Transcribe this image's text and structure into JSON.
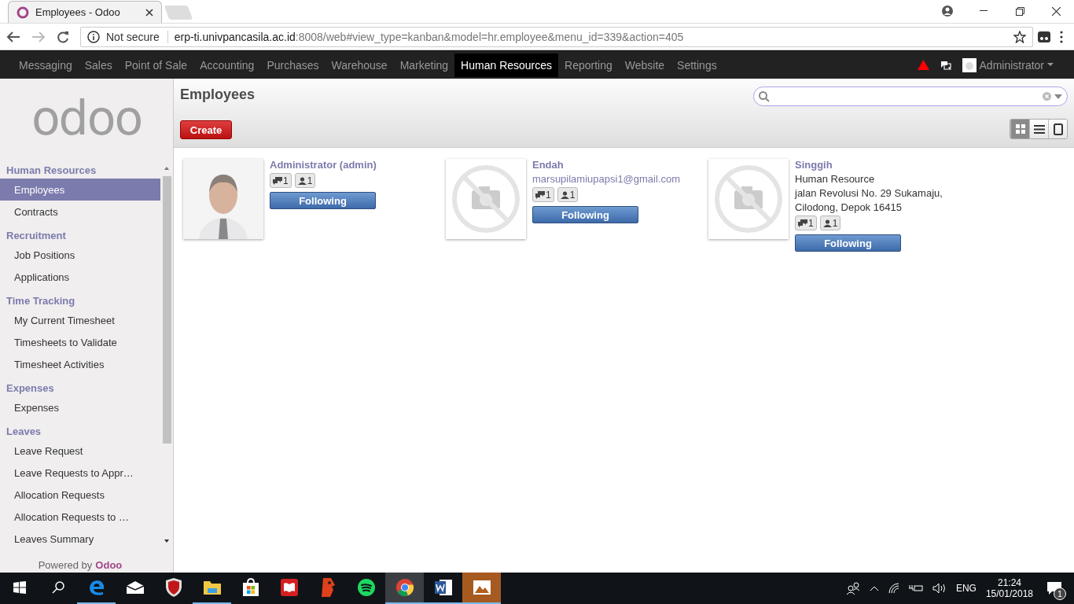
{
  "browser": {
    "tab_title": "Employees - Odoo",
    "security": "Not secure",
    "url_host": "erp-ti.univpancasila.ac.id",
    "url_rest": ":8008/web#view_type=kanban&model=hr.employee&menu_id=339&action=405"
  },
  "topnav": {
    "items": [
      {
        "label": "Messaging",
        "selected": false
      },
      {
        "label": "Sales",
        "selected": false
      },
      {
        "label": "Point of Sale",
        "selected": false
      },
      {
        "label": "Accounting",
        "selected": false
      },
      {
        "label": "Purchases",
        "selected": false
      },
      {
        "label": "Warehouse",
        "selected": false
      },
      {
        "label": "Marketing",
        "selected": false
      },
      {
        "label": "Human Resources",
        "selected": true
      },
      {
        "label": "Reporting",
        "selected": false
      },
      {
        "label": "Website",
        "selected": false
      },
      {
        "label": "Settings",
        "selected": false
      }
    ],
    "user": "Administrator"
  },
  "sidebar": {
    "logo": "odoo",
    "sections": [
      {
        "title": "Human Resources",
        "items": [
          {
            "label": "Employees",
            "selected": true
          },
          {
            "label": "Contracts",
            "selected": false
          }
        ]
      },
      {
        "title": "Recruitment",
        "items": [
          {
            "label": "Job Positions",
            "selected": false
          },
          {
            "label": "Applications",
            "selected": false
          }
        ]
      },
      {
        "title": "Time Tracking",
        "items": [
          {
            "label": "My Current Timesheet",
            "selected": false
          },
          {
            "label": "Timesheets to Validate",
            "selected": false
          },
          {
            "label": "Timesheet Activities",
            "selected": false
          }
        ]
      },
      {
        "title": "Expenses",
        "items": [
          {
            "label": "Expenses",
            "selected": false
          }
        ]
      },
      {
        "title": "Leaves",
        "items": [
          {
            "label": "Leave Request",
            "selected": false
          },
          {
            "label": "Leave Requests to Appr…",
            "selected": false
          },
          {
            "label": "Allocation Requests",
            "selected": false
          },
          {
            "label": "Allocation Requests to …",
            "selected": false
          },
          {
            "label": "Leaves Summary",
            "selected": false
          }
        ]
      }
    ],
    "powered_prefix": "Powered by",
    "powered_brand": "Odoo"
  },
  "page": {
    "title": "Employees",
    "create": "Create",
    "views": [
      {
        "kind": "kanban",
        "selected": true
      },
      {
        "kind": "list",
        "selected": false
      },
      {
        "kind": "form",
        "selected": false
      }
    ]
  },
  "employees": [
    {
      "name": "Administrator (admin)",
      "has_photo": true,
      "messages": "1",
      "followers": "1",
      "button": "Following"
    },
    {
      "name": "Endah",
      "has_photo": false,
      "lines": [
        "marsupilamiupapsi1@gmail.com"
      ],
      "messages": "1",
      "followers": "1",
      "button": "Following"
    },
    {
      "name": "Singgih",
      "has_photo": false,
      "lines": [
        "Human Resource",
        "jalan Revolusi No. 29 Sukamaju,",
        "Cilodong, Depok 16415"
      ],
      "messages": "1",
      "followers": "1",
      "button": "Following"
    }
  ],
  "taskbar": {
    "apps": [
      {
        "kind": "edge",
        "running": true,
        "selected": false
      },
      {
        "kind": "mail",
        "running": false,
        "selected": false
      },
      {
        "kind": "shield",
        "running": false,
        "selected": false
      },
      {
        "kind": "folder",
        "running": true,
        "selected": false
      },
      {
        "kind": "store",
        "running": false,
        "selected": false
      },
      {
        "kind": "book",
        "running": false,
        "selected": false
      },
      {
        "kind": "face",
        "running": false,
        "selected": false
      },
      {
        "kind": "music",
        "running": false,
        "selected": false
      },
      {
        "kind": "browser",
        "running": true,
        "selected": true
      },
      {
        "kind": "word",
        "running": true,
        "selected": false
      },
      {
        "kind": "photos",
        "running": true,
        "selected": false
      }
    ],
    "language": "ENG",
    "time": "21:24",
    "date": "15/01/2018",
    "notifications": "1"
  }
}
